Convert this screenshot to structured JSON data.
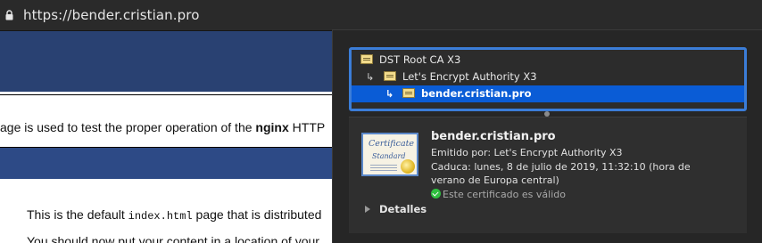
{
  "browser": {
    "url": "https://bender.cristian.pro",
    "lock_icon": "lock-icon"
  },
  "webpage": {
    "intro_prefix": "age is used to test the proper operation of the ",
    "intro_bold": "nginx",
    "intro_suffix": " HTTP",
    "p1_prefix": "This is the default ",
    "p1_code": "index.html",
    "p1_suffix": " page that is distributed",
    "p2": "You should now put your content in a location of your"
  },
  "certificate": {
    "chain": [
      {
        "label": "DST Root CA X3",
        "icon": "certificate-icon"
      },
      {
        "label": "Let's Encrypt Authority X3",
        "icon": "certificate-icon"
      },
      {
        "label": "bender.cristian.pro",
        "icon": "certificate-icon",
        "selected": true
      }
    ],
    "image_title": "Certificate",
    "image_subtitle": "Standard",
    "common_name": "bender.cristian.pro",
    "issuer": "Emitido por: Let's Encrypt Authority X3",
    "expiry": "Caduca: lunes, 8 de julio de 2019, 11:32:10 (hora de verano de Europa central)",
    "status": "Este certificado es válido",
    "details_label": "Detalles",
    "colors": {
      "selection": "#0a5cd6",
      "focus_ring": "#3b7dd8",
      "valid": "#2fbf3f"
    }
  }
}
